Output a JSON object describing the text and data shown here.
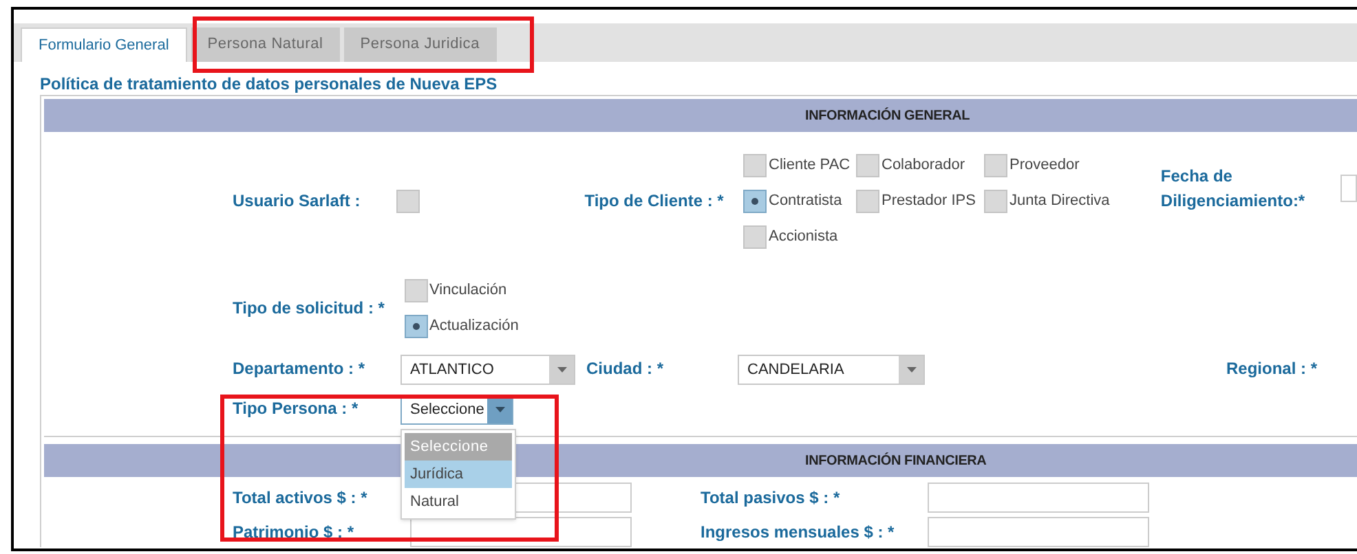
{
  "tabs": [
    {
      "label": "Formulario General",
      "selected": true
    },
    {
      "label": "Persona Natural",
      "selected": false
    },
    {
      "label": "Persona Juridica",
      "selected": false
    }
  ],
  "policy_title": "Política de tratamiento de datos personales de Nueva EPS",
  "general_section": {
    "title": "INFORMACIÓN GENERAL",
    "usuario_sarlaft": {
      "label": "Usuario Sarlaft :",
      "checked": false
    },
    "tipo_cliente": {
      "label": "Tipo de Cliente : *",
      "options": [
        {
          "label": "Cliente PAC",
          "selected": false
        },
        {
          "label": "Colaborador",
          "selected": false
        },
        {
          "label": "Proveedor",
          "selected": false
        },
        {
          "label": "Contratista",
          "selected": true
        },
        {
          "label": "Prestador IPS",
          "selected": false
        },
        {
          "label": "Junta Directiva",
          "selected": false
        },
        {
          "label": "Accionista",
          "selected": false
        }
      ]
    },
    "fecha": {
      "label": "Fecha de Diligenciamiento:*"
    },
    "tipo_solicitud": {
      "label": "Tipo de solicitud : *",
      "options": [
        {
          "label": "Vinculación",
          "selected": false
        },
        {
          "label": "Actualización",
          "selected": true
        }
      ]
    },
    "departamento": {
      "label": "Departamento : *",
      "value": "ATLANTICO"
    },
    "ciudad": {
      "label": "Ciudad : *",
      "value": "CANDELARIA"
    },
    "regional": {
      "label": "Regional : *"
    },
    "tipo_persona": {
      "label": "Tipo Persona : *",
      "value": "Seleccione",
      "expanded": true,
      "options": [
        {
          "label": "Seleccione",
          "selected": true,
          "highlighted": false
        },
        {
          "label": "Jurídica",
          "selected": false,
          "highlighted": true
        },
        {
          "label": "Natural",
          "selected": false,
          "highlighted": false
        }
      ]
    }
  },
  "financial_section": {
    "title": "INFORMACIÓN FINANCIERA",
    "fields": [
      {
        "label": "Total activos $ : *"
      },
      {
        "label": "Total pasivos $ : *"
      },
      {
        "label": "Patrimonio $ : *"
      },
      {
        "label": "Ingresos mensuales $ : *"
      }
    ]
  }
}
